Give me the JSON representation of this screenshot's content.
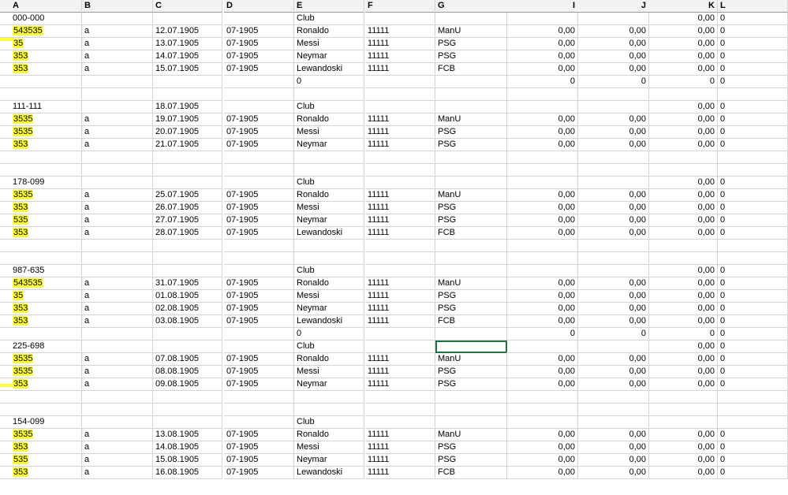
{
  "columns": [
    "A",
    "B",
    "C",
    "D",
    "E",
    "F",
    "G",
    "I",
    "J",
    "K",
    "L"
  ],
  "rows": [
    [
      "000-000",
      "",
      "",
      "",
      "Club",
      "",
      "",
      "",
      "",
      "0,00",
      "0"
    ],
    [
      "543535",
      "a",
      "12.07.1905",
      "07-1905",
      "Ronaldo",
      "11111",
      "ManU",
      "0,00",
      "0,00",
      "0,00",
      "0"
    ],
    [
      "35",
      "a",
      "13.07.1905",
      "07-1905",
      "Messi",
      "11111",
      "PSG",
      "0,00",
      "0,00",
      "0,00",
      "0"
    ],
    [
      "353",
      "a",
      "14.07.1905",
      "07-1905",
      "Neymar",
      "11111",
      "PSG",
      "0,00",
      "0,00",
      "0,00",
      "0"
    ],
    [
      "353",
      "a",
      "15.07.1905",
      "07-1905",
      "Lewandoski",
      "11111",
      "FCB",
      "0,00",
      "0,00",
      "0,00",
      "0"
    ],
    [
      "",
      "",
      "",
      "",
      "0",
      "",
      "",
      "0",
      "0",
      "0",
      "0"
    ],
    [
      "",
      "",
      "",
      "",
      "",
      "",
      "",
      "",
      "",
      "",
      ""
    ],
    [
      "111-111",
      "",
      "18.07.1905",
      "",
      "Club",
      "",
      "",
      "",
      "",
      "0,00",
      "0"
    ],
    [
      "3535",
      "a",
      "19.07.1905",
      "07-1905",
      "Ronaldo",
      "11111",
      "ManU",
      "0,00",
      "0,00",
      "0,00",
      "0"
    ],
    [
      "3535",
      "a",
      "20.07.1905",
      "07-1905",
      "Messi",
      "11111",
      "PSG",
      "0,00",
      "0,00",
      "0,00",
      "0"
    ],
    [
      "353",
      "a",
      "21.07.1905",
      "07-1905",
      "Neymar",
      "11111",
      "PSG",
      "0,00",
      "0,00",
      "0,00",
      "0"
    ],
    [
      "",
      "",
      "",
      "",
      "",
      "",
      "",
      "",
      "",
      "",
      ""
    ],
    [
      "",
      "",
      "",
      "",
      "",
      "",
      "",
      "",
      "",
      "",
      ""
    ],
    [
      "178-099",
      "",
      "",
      "",
      "Club",
      "",
      "",
      "",
      "",
      "0,00",
      "0"
    ],
    [
      "3535",
      "a",
      "25.07.1905",
      "07-1905",
      "Ronaldo",
      "11111",
      "ManU",
      "0,00",
      "0,00",
      "0,00",
      "0"
    ],
    [
      "353",
      "a",
      "26.07.1905",
      "07-1905",
      "Messi",
      "11111",
      "PSG",
      "0,00",
      "0,00",
      "0,00",
      "0"
    ],
    [
      "535",
      "a",
      "27.07.1905",
      "07-1905",
      "Neymar",
      "11111",
      "PSG",
      "0,00",
      "0,00",
      "0,00",
      "0"
    ],
    [
      "353",
      "a",
      "28.07.1905",
      "07-1905",
      "Lewandoski",
      "11111",
      "FCB",
      "0,00",
      "0,00",
      "0,00",
      "0"
    ],
    [
      "",
      "",
      "",
      "",
      "",
      "",
      "",
      "",
      "",
      "",
      ""
    ],
    [
      "",
      "",
      "",
      "",
      "",
      "",
      "",
      "",
      "",
      "",
      ""
    ],
    [
      "987-635",
      "",
      "",
      "",
      "Club",
      "",
      "",
      "",
      "",
      "0,00",
      "0"
    ],
    [
      "543535",
      "a",
      "31.07.1905",
      "07-1905",
      "Ronaldo",
      "11111",
      "ManU",
      "0,00",
      "0,00",
      "0,00",
      "0"
    ],
    [
      "35",
      "a",
      "01.08.1905",
      "07-1905",
      "Messi",
      "11111",
      "PSG",
      "0,00",
      "0,00",
      "0,00",
      "0"
    ],
    [
      "353",
      "a",
      "02.08.1905",
      "07-1905",
      "Neymar",
      "11111",
      "PSG",
      "0,00",
      "0,00",
      "0,00",
      "0"
    ],
    [
      "353",
      "a",
      "03.08.1905",
      "07-1905",
      "Lewandoski",
      "11111",
      "FCB",
      "0,00",
      "0,00",
      "0,00",
      "0"
    ],
    [
      "",
      "",
      "",
      "",
      "0",
      "",
      "",
      "0",
      "0",
      "0",
      "0"
    ],
    [
      "225-698",
      "",
      "",
      "",
      "Club",
      "",
      "",
      "",
      "",
      "0,00",
      "0"
    ],
    [
      "3535",
      "a",
      "07.08.1905",
      "07-1905",
      "Ronaldo",
      "11111",
      "ManU",
      "0,00",
      "0,00",
      "0,00",
      "0"
    ],
    [
      "3535",
      "a",
      "08.08.1905",
      "07-1905",
      "Messi",
      "11111",
      "PSG",
      "0,00",
      "0,00",
      "0,00",
      "0"
    ],
    [
      "353",
      "a",
      "09.08.1905",
      "07-1905",
      "Neymar",
      "11111",
      "PSG",
      "0,00",
      "0,00",
      "0,00",
      "0"
    ],
    [
      "",
      "",
      "",
      "",
      "",
      "",
      "",
      "",
      "",
      "",
      ""
    ],
    [
      "",
      "",
      "",
      "",
      "",
      "",
      "",
      "",
      "",
      "",
      ""
    ],
    [
      "154-099",
      "",
      "",
      "",
      "Club",
      "",
      "",
      "",
      "",
      "",
      ""
    ],
    [
      "3535",
      "a",
      "13.08.1905",
      "07-1905",
      "Ronaldo",
      "11111",
      "ManU",
      "0,00",
      "0,00",
      "0,00",
      "0"
    ],
    [
      "353",
      "a",
      "14.08.1905",
      "07-1905",
      "Messi",
      "11111",
      "PSG",
      "0,00",
      "0,00",
      "0,00",
      "0"
    ],
    [
      "535",
      "a",
      "15.08.1905",
      "07-1905",
      "Neymar",
      "11111",
      "PSG",
      "0,00",
      "0,00",
      "0,00",
      "0"
    ],
    [
      "353",
      "a",
      "16.08.1905",
      "07-1905",
      "Lewandoski",
      "11111",
      "FCB",
      "0,00",
      "0,00",
      "0,00",
      "0"
    ]
  ],
  "highlight_color": "#ffff38",
  "selection_color": "#217346"
}
